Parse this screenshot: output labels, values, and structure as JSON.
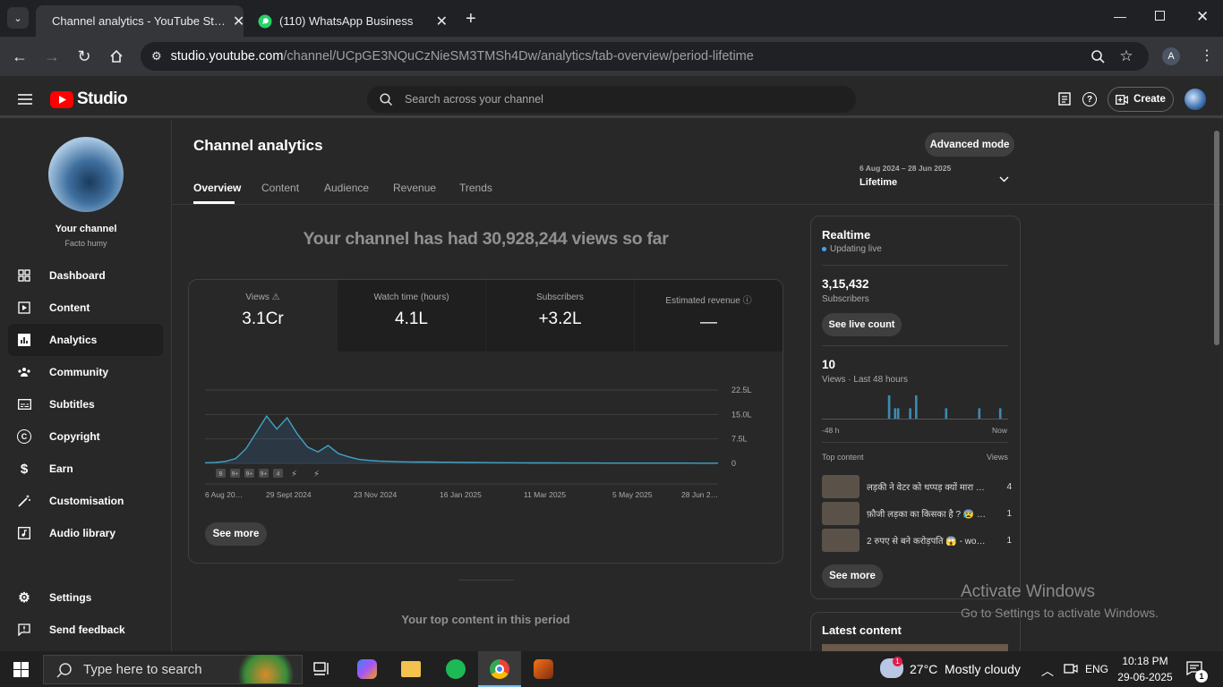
{
  "browser": {
    "tabs": [
      {
        "label": "Channel analytics - YouTube St…",
        "icon": "youtube-icon"
      },
      {
        "label": "(110) WhatsApp Business",
        "icon": "whatsapp-icon"
      }
    ],
    "url_host": "studio.youtube.com",
    "url_path": "/channel/UCpGE3NQuCzNieSM3TMSh4Dw/analytics/tab-overview/period-lifetime",
    "profile_initial": "A"
  },
  "studio": {
    "logo_text": "Studio",
    "search_placeholder": "Search across your channel",
    "create_label": "Create"
  },
  "sidebar": {
    "channel_title": "Your channel",
    "channel_name": "Facto humy",
    "items": [
      {
        "label": "Dashboard",
        "icon": "dashboard-icon"
      },
      {
        "label": "Content",
        "icon": "content-icon"
      },
      {
        "label": "Analytics",
        "icon": "analytics-icon"
      },
      {
        "label": "Community",
        "icon": "community-icon"
      },
      {
        "label": "Subtitles",
        "icon": "subtitles-icon"
      },
      {
        "label": "Copyright",
        "icon": "copyright-icon"
      },
      {
        "label": "Earn",
        "icon": "earn-icon"
      },
      {
        "label": "Customisation",
        "icon": "customisation-icon"
      },
      {
        "label": "Audio library",
        "icon": "audio-library-icon"
      }
    ],
    "settings": "Settings",
    "feedback": "Send feedback"
  },
  "main": {
    "title": "Channel analytics",
    "advanced_mode": "Advanced mode",
    "tabs": [
      "Overview",
      "Content",
      "Audience",
      "Revenue",
      "Trends"
    ],
    "active_tab": "Overview",
    "period_range": "6 Aug 2024 – 28 Jun 2025",
    "period_label": "Lifetime",
    "headline": "Your channel has had 30,928,244 views so far",
    "metrics": [
      {
        "label": "Views",
        "value": "3.1Cr"
      },
      {
        "label": "Watch time (hours)",
        "value": "4.1L"
      },
      {
        "label": "Subscribers",
        "value": "+3.2L"
      },
      {
        "label": "Estimated revenue",
        "value": "—"
      }
    ],
    "see_more": "See more",
    "top_content_title": "Your top content in this period"
  },
  "chart_data": {
    "type": "line",
    "x_tick_labels": [
      "6 Aug 20…",
      "29 Sept 2024",
      "23 Nov 2024",
      "16 Jan 2025",
      "11 Mar 2025",
      "5 May 2025",
      "28 Jun 2…"
    ],
    "y_tick_labels": [
      "22.5L",
      "15.0L",
      "7.5L",
      "0"
    ],
    "ylim": [
      0,
      2250000
    ],
    "series": [
      {
        "values": [
          20000,
          30000,
          60000,
          150000,
          450000,
          950000,
          1450000,
          1050000,
          1400000,
          900000,
          500000,
          350000,
          550000,
          300000,
          200000,
          120000,
          90000,
          70000,
          60000,
          50000,
          45000,
          40000,
          40000,
          35000,
          35000,
          30000,
          28000,
          25000,
          22000,
          20000,
          18000,
          16000,
          15000,
          14000,
          13000,
          12000,
          11000,
          10000,
          10000,
          9000,
          9000,
          8000,
          8000,
          8000,
          7000,
          7000,
          7000,
          7000,
          6000,
          6000,
          6000
        ]
      }
    ],
    "grid": true,
    "annotation_markers": [
      "B",
      "9+",
      "9+",
      "9+",
      "4"
    ]
  },
  "realtime": {
    "title": "Realtime",
    "status": "Updating live",
    "subs_value": "3,15,432",
    "subs_label": "Subscribers",
    "live_count": "See live count",
    "views_value": "10",
    "views_label": "Views · Last 48 hours",
    "x_left": "-48 h",
    "x_right": "Now",
    "bars": [
      0,
      0,
      0,
      0,
      0,
      0,
      0,
      0,
      0,
      0,
      0,
      0,
      0,
      0,
      0,
      0,
      0,
      0,
      0,
      0,
      0,
      0,
      9,
      0,
      4,
      4,
      0,
      0,
      0,
      4,
      0,
      9,
      0,
      0,
      0,
      0,
      0,
      0,
      0,
      0,
      0,
      4,
      0,
      0,
      0,
      0,
      0,
      0,
      0,
      0,
      0,
      0,
      4,
      0,
      0,
      0,
      0,
      0,
      0,
      4,
      0,
      0
    ],
    "top_content_label": "Top content",
    "views_col": "Views",
    "videos": [
      {
        "title": "लड़की ने वेटर को थप्पड़ क्यों मारा …",
        "views": "4"
      },
      {
        "title": "फ़ौजी लड़का का किसका है ? 😰 …",
        "views": "1"
      },
      {
        "title": "2 रुपए से बने करोड़पति 😱 - wo…",
        "views": "1"
      }
    ],
    "see_more": "See more"
  },
  "latest": {
    "title": "Latest content"
  },
  "watermark": {
    "line1": "Activate Windows",
    "line2": "Go to Settings to activate Windows."
  },
  "taskbar": {
    "search_placeholder": "Type here to search",
    "weather": "27°C  Mostly cloudy",
    "lang": "ENG",
    "time": "10:18 PM",
    "date": "29-06-2025",
    "notifications": "1"
  }
}
